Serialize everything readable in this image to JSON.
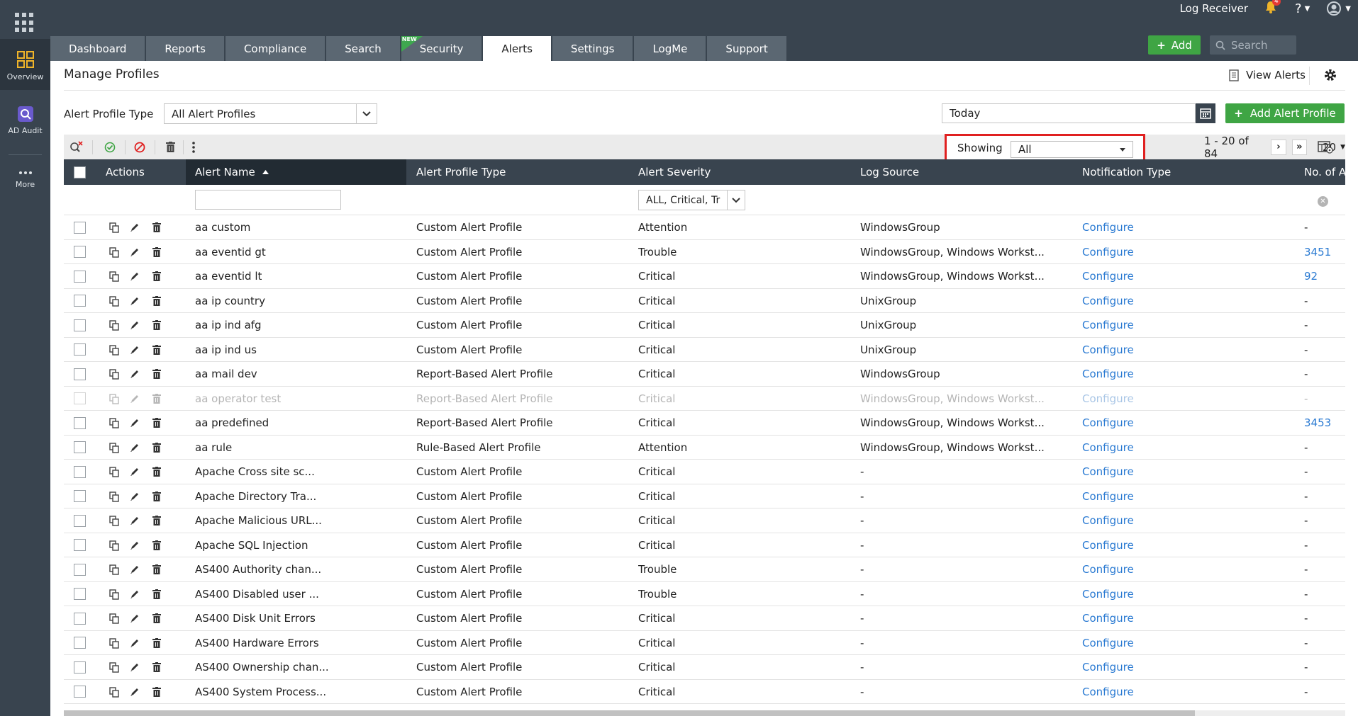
{
  "rail": {
    "items": [
      {
        "label": "Overview",
        "icon": "grid-icon"
      },
      {
        "label": "AD Audit",
        "icon": "ad-audit-icon"
      },
      {
        "label": "More",
        "icon": "more-icon"
      }
    ]
  },
  "header": {
    "product": "Log Receiver",
    "notification_count": "4",
    "help": "?",
    "tabs": [
      {
        "label": "Dashboard"
      },
      {
        "label": "Reports"
      },
      {
        "label": "Compliance"
      },
      {
        "label": "Search"
      },
      {
        "label": "Security",
        "flag": "NEW"
      },
      {
        "label": "Alerts",
        "active": true
      },
      {
        "label": "Settings"
      },
      {
        "label": "LogMe"
      },
      {
        "label": "Support"
      }
    ],
    "add_label": "Add",
    "search_placeholder": "Search"
  },
  "page": {
    "title": "Manage Profiles",
    "view_alerts": "View Alerts"
  },
  "filters": {
    "profile_type_label": "Alert Profile Type",
    "profile_type_value": "All Alert Profiles",
    "date_value": "Today",
    "add_profile_label": "Add Alert Profile"
  },
  "toolbar": {
    "showing_label": "Showing",
    "showing_value": "All",
    "range_text": "1 - 20 of 84",
    "per_page": "20"
  },
  "table": {
    "columns": {
      "actions": "Actions",
      "name": "Alert Name",
      "type": "Alert Profile Type",
      "severity": "Alert Severity",
      "source": "Log Source",
      "notification": "Notification Type",
      "count": "No. of Al"
    },
    "severity_filter": "ALL, Critical, Tr",
    "rows": [
      {
        "name": "aa custom",
        "type": "Custom Alert Profile",
        "severity": "Attention",
        "source": "WindowsGroup",
        "notification": "Configure",
        "count": "-"
      },
      {
        "name": "aa eventid gt",
        "type": "Custom Alert Profile",
        "severity": "Trouble",
        "source": "WindowsGroup, Windows Workst...",
        "notification": "Configure",
        "count": "3451"
      },
      {
        "name": "aa eventid lt",
        "type": "Custom Alert Profile",
        "severity": "Critical",
        "source": "WindowsGroup, Windows Workst...",
        "notification": "Configure",
        "count": "92"
      },
      {
        "name": "aa ip country",
        "type": "Custom Alert Profile",
        "severity": "Critical",
        "source": "UnixGroup",
        "notification": "Configure",
        "count": "-"
      },
      {
        "name": "aa ip ind afg",
        "type": "Custom Alert Profile",
        "severity": "Critical",
        "source": "UnixGroup",
        "notification": "Configure",
        "count": "-"
      },
      {
        "name": "aa ip ind us",
        "type": "Custom Alert Profile",
        "severity": "Critical",
        "source": "UnixGroup",
        "notification": "Configure",
        "count": "-"
      },
      {
        "name": "aa mail dev",
        "type": "Report-Based Alert Profile",
        "severity": "Critical",
        "source": "WindowsGroup",
        "notification": "Configure",
        "count": "-"
      },
      {
        "name": "aa operator test",
        "type": "Report-Based Alert Profile",
        "severity": "Critical",
        "source": "WindowsGroup, Windows Workst...",
        "notification": "Configure",
        "count": "-",
        "disabled": true
      },
      {
        "name": "aa predefined",
        "type": "Report-Based Alert Profile",
        "severity": "Critical",
        "source": "WindowsGroup, Windows Workst...",
        "notification": "Configure",
        "count": "3453"
      },
      {
        "name": "aa rule",
        "type": "Rule-Based Alert Profile",
        "severity": "Attention",
        "source": "WindowsGroup, Windows Workst...",
        "notification": "Configure",
        "count": "-"
      },
      {
        "name": "Apache Cross site sc...",
        "type": "Custom Alert Profile",
        "severity": "Critical",
        "source": "-",
        "notification": "Configure",
        "count": "-"
      },
      {
        "name": "Apache Directory Tra...",
        "type": "Custom Alert Profile",
        "severity": "Critical",
        "source": "-",
        "notification": "Configure",
        "count": "-"
      },
      {
        "name": "Apache Malicious URL...",
        "type": "Custom Alert Profile",
        "severity": "Critical",
        "source": "-",
        "notification": "Configure",
        "count": "-"
      },
      {
        "name": "Apache SQL Injection",
        "type": "Custom Alert Profile",
        "severity": "Critical",
        "source": "-",
        "notification": "Configure",
        "count": "-"
      },
      {
        "name": "AS400 Authority chan...",
        "type": "Custom Alert Profile",
        "severity": "Trouble",
        "source": "-",
        "notification": "Configure",
        "count": "-"
      },
      {
        "name": "AS400 Disabled user ...",
        "type": "Custom Alert Profile",
        "severity": "Trouble",
        "source": "-",
        "notification": "Configure",
        "count": "-"
      },
      {
        "name": "AS400 Disk Unit Errors",
        "type": "Custom Alert Profile",
        "severity": "Critical",
        "source": "-",
        "notification": "Configure",
        "count": "-"
      },
      {
        "name": "AS400 Hardware Errors",
        "type": "Custom Alert Profile",
        "severity": "Critical",
        "source": "-",
        "notification": "Configure",
        "count": "-"
      },
      {
        "name": "AS400 Ownership chan...",
        "type": "Custom Alert Profile",
        "severity": "Critical",
        "source": "-",
        "notification": "Configure",
        "count": "-"
      },
      {
        "name": "AS400 System Process...",
        "type": "Custom Alert Profile",
        "severity": "Critical",
        "source": "-",
        "notification": "Configure",
        "count": "-"
      }
    ]
  },
  "colors": {
    "header_bg": "#39444f",
    "tab_bg": "#5b6772",
    "accent_green": "#3fa544",
    "link_blue": "#2a7ad2",
    "highlight_red": "#e02020"
  }
}
